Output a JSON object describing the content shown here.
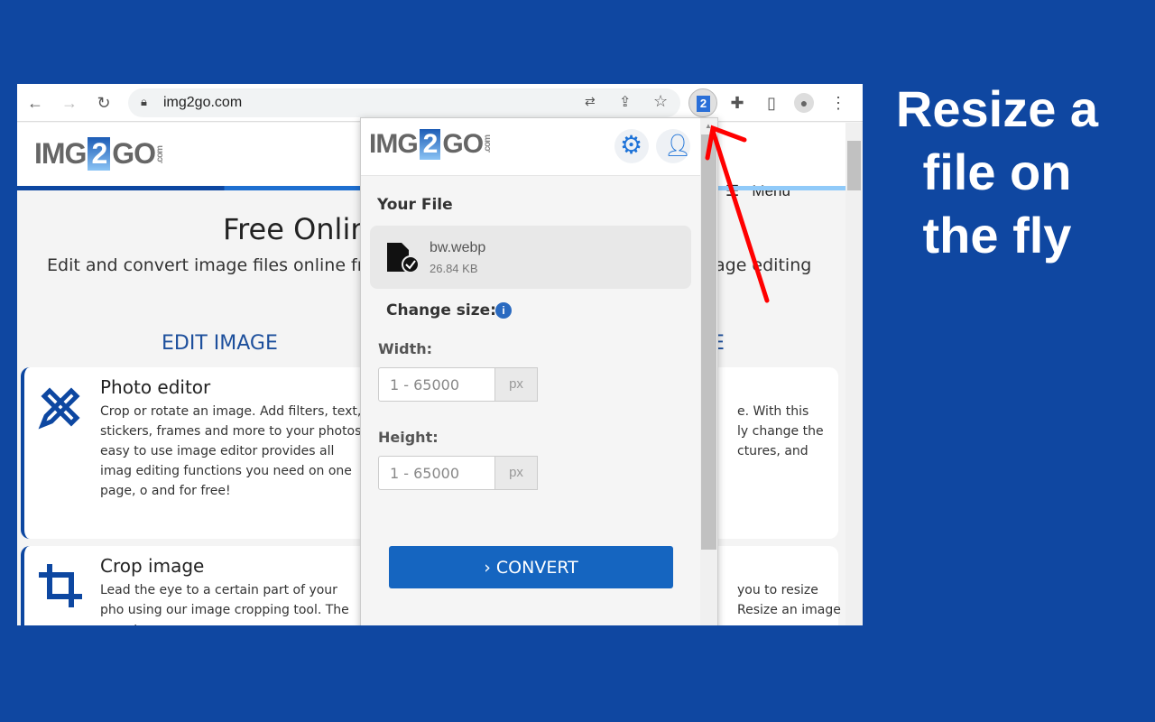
{
  "browser": {
    "url": "img2go.com",
    "extension_badge": "2"
  },
  "site": {
    "logo": "IMG2GO",
    "menu_label": "Menu",
    "hero_title": "Free Onlin",
    "hero_subtitle_left": "Edit and convert image files online fr",
    "hero_subtitle_right": "age editing",
    "edit_image_heading": "EDIT IMAGE",
    "edit_image_heading_right": "E",
    "cards": [
      {
        "title": "Photo editor",
        "text": "Crop or rotate an image. Add filters, text, stickers, frames and more to your photos easy to use image editor provides all imag editing functions you need on one page, o and for free!",
        "right_text": "e. With this\nly change the\nctures, and"
      },
      {
        "title": "Crop image",
        "text": "Lead the eye to a certain part of your pho using our image cropping tool. The easy t",
        "right_text": "you to resize\nResize an image"
      }
    ]
  },
  "popup": {
    "logo": "IMG2GO",
    "your_file_label": "Your File",
    "file_name": "bw.webp",
    "file_size": "26.84 KB",
    "change_size_label": "Change size:",
    "width_label": "Width:",
    "width_placeholder": "1 - 65000",
    "height_label": "Height:",
    "height_placeholder": "1 - 65000",
    "unit": "px",
    "convert_label": "CONVERT"
  },
  "tagline": "Resize a file on the fly",
  "colors": {
    "background": "#0f47a1",
    "accent": "#1565c0",
    "arrow": "#ff0000"
  }
}
